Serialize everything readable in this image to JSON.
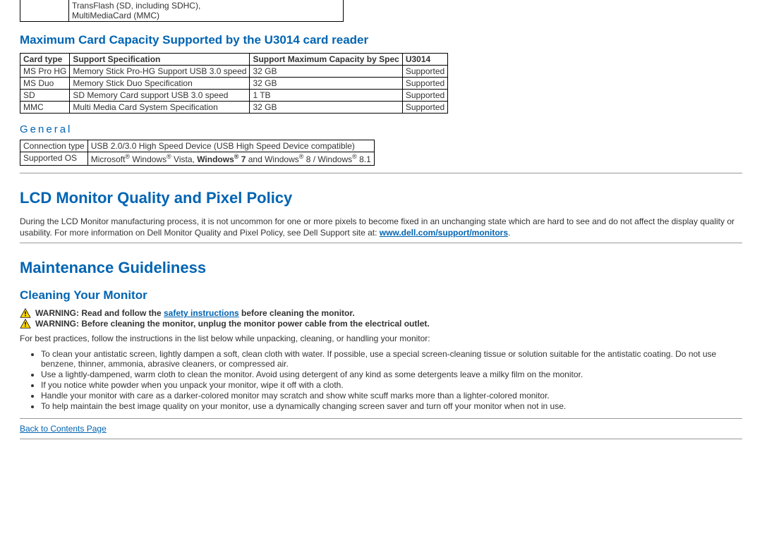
{
  "top_fragment": {
    "left": "",
    "right_line1": "TransFlash (SD, including SDHC),",
    "right_line2": "MultiMediaCard (MMC)"
  },
  "card_capacity": {
    "heading": "Maximum Card Capacity Supported by the U3014 card reader",
    "headers": [
      "Card type",
      "Support Specification",
      "Support Maximum Capacity by Spec",
      "U3014"
    ],
    "rows": [
      [
        "MS Pro HG",
        "Memory Stick Pro-HG Support USB 3.0 speed",
        "32 GB",
        "Supported"
      ],
      [
        "MS Duo",
        "Memory Stick Duo Specification",
        "32 GB",
        "Supported"
      ],
      [
        "SD",
        "SD Memory Card support USB 3.0 speed",
        "1 TB",
        "Supported"
      ],
      [
        "MMC",
        "Multi Media Card System Specification",
        "32 GB",
        "Supported"
      ]
    ]
  },
  "general": {
    "heading": "General",
    "rows": [
      [
        "Connection type",
        "USB 2.0/3.0 High Speed Device (USB High Speed Device compatible)"
      ],
      [
        "Supported OS",
        "Microsoft® Windows® Vista, Windows® 7 and Windows® 8 / Windows® 8.1"
      ]
    ],
    "os_label": "Supported OS",
    "os_p1": "Microsoft",
    "os_p2": " Windows",
    "os_p3": " Vista, ",
    "os_p4": "Windows",
    "os_p5": "  7",
    "os_p6": " and Windows",
    "os_p7": " 8 / Windows",
    "os_p8": " 8.1"
  },
  "pixel_policy": {
    "heading": "LCD Monitor Quality and Pixel Policy",
    "body_pre": "During the LCD Monitor manufacturing process, it is not uncommon for one or more pixels to become fixed in an unchanging state which are hard to see and do not affect the display quality or usability. For more information on Dell Monitor Quality and Pixel Policy, see Dell Support site at: ",
    "link": "www.dell.com/support/monitors",
    "body_post": "."
  },
  "maintenance": {
    "heading": "Maintenance Guideliness",
    "subheading": "Cleaning Your Monitor",
    "warn1_pre": "WARNING: Read and follow the ",
    "warn1_link": "safety instructions",
    "warn1_post": " before cleaning the monitor.",
    "warn2": "WARNING: Before cleaning the monitor, unplug the monitor power cable from the electrical outlet.",
    "intro": "For best practices, follow the instructions in the list below while unpacking, cleaning, or handling your monitor:",
    "bullets": [
      "To clean your antistatic screen, lightly dampen a soft, clean cloth with water. If possible, use a special screen-cleaning tissue or solution suitable for the antistatic coating. Do not use benzene, thinner, ammonia, abrasive cleaners, or compressed air.",
      "Use a lightly-dampened, warm cloth to clean the monitor. Avoid using detergent of any kind as some detergents leave a milky film on the monitor.",
      "If you notice white powder when you unpack your monitor, wipe it off with a cloth.",
      "Handle your monitor with care as a darker-colored monitor may scratch and show white scuff marks more than a lighter-colored monitor.",
      "To help maintain the best image quality on your monitor, use a dynamically changing screen saver and turn off your monitor when not in use."
    ]
  },
  "footer_link": "Back to Contents Page",
  "reg_mark": "®",
  "chart_data": {
    "type": "table",
    "title": "Maximum Card Capacity Supported by the U3014 card reader",
    "columns": [
      "Card type",
      "Support Specification",
      "Support Maximum Capacity by Spec",
      "U3014"
    ],
    "rows": [
      [
        "MS Pro HG",
        "Memory Stick Pro-HG Support USB 3.0 speed",
        "32 GB",
        "Supported"
      ],
      [
        "MS Duo",
        "Memory Stick Duo Specification",
        "32 GB",
        "Supported"
      ],
      [
        "SD",
        "SD Memory Card support USB 3.0 speed",
        "1 TB",
        "Supported"
      ],
      [
        "MMC",
        "Multi Media Card System Specification",
        "32 GB",
        "Supported"
      ]
    ]
  }
}
